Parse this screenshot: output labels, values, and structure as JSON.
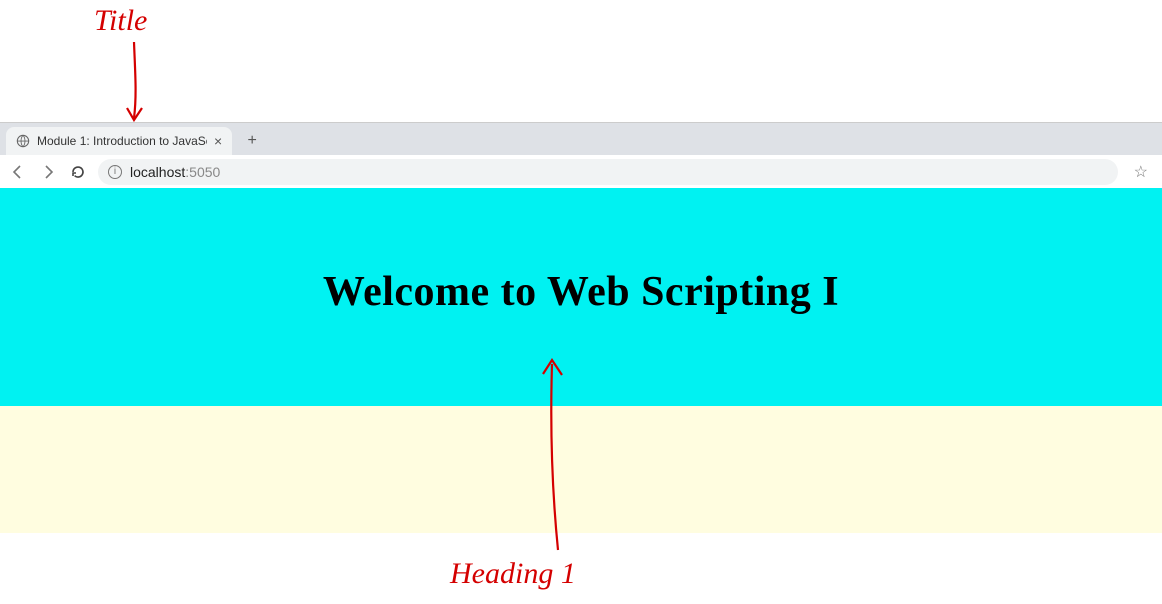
{
  "annotations": {
    "title_label": "Title",
    "heading_label": "Heading 1"
  },
  "browser": {
    "tab": {
      "title": "Module 1: Introduction to JavaSc",
      "close_glyph": "×"
    },
    "new_tab_glyph": "+",
    "address": {
      "host": "localhost",
      "port": ":5050"
    },
    "info_glyph": "i",
    "star_glyph": "☆"
  },
  "page": {
    "heading": "Welcome to Web Scripting I"
  }
}
